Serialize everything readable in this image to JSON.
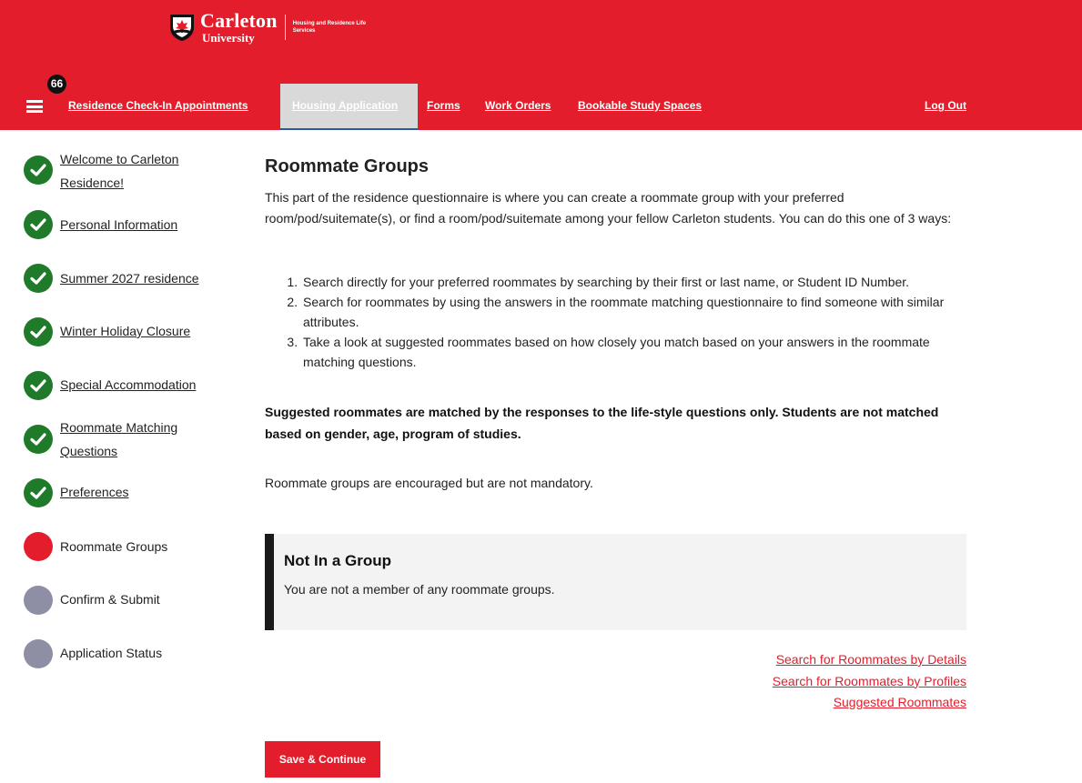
{
  "header": {
    "logo_name": "Carleton",
    "logo_university": "University",
    "logo_department": "Housing and Residence Life Services",
    "notification_count": "66",
    "nav": [
      {
        "label": "Residence Check-In Appointments"
      },
      {
        "label": "Housing Application",
        "active": true
      },
      {
        "label": "Forms"
      },
      {
        "label": "Work Orders"
      },
      {
        "label": "Bookable Study Spaces"
      }
    ],
    "logout_label": "Log Out"
  },
  "sidebar": {
    "steps": [
      {
        "label": "Welcome to Carleton Residence!",
        "status": "complete"
      },
      {
        "label": "Personal Information",
        "status": "complete"
      },
      {
        "label": "Summer 2027 residence",
        "status": "complete"
      },
      {
        "label": "Winter Holiday Closure",
        "status": "complete"
      },
      {
        "label": "Special Accommodation",
        "status": "complete"
      },
      {
        "label": "Roommate Matching Questions",
        "status": "complete"
      },
      {
        "label": "Preferences",
        "status": "complete"
      },
      {
        "label": "Roommate Groups",
        "status": "current"
      },
      {
        "label": "Confirm & Submit",
        "status": "pending"
      },
      {
        "label": "Application Status",
        "status": "pending"
      }
    ]
  },
  "main": {
    "title": "Roommate Groups",
    "intro": "This part of the residence questionnaire is where you can create a roommate group with your preferred room/pod/suitemate(s), or find a room/pod/suitemate among your fellow Carleton students. You can do this one of 3 ways:",
    "ways": [
      "Search directly for your preferred roommates by searching by their first or last name, or Student ID Number.",
      "Search for roommates by using the answers in the roommate matching questionnaire to find someone with similar attributes.",
      "Take a look at suggested roommates based on how closely you match based on your answers in the roommate matching questions."
    ],
    "note": "Suggested roommates are matched by the responses to the life-style questions only. Students are not matched based on gender, age, program of studies.",
    "encouraged": "Roommate groups are encouraged but are not mandatory.",
    "group_box": {
      "title": "Not In a Group",
      "text": "You are not a member of any roommate groups."
    },
    "links": [
      "Search for Roommates by Details",
      "Search for Roommates by Profiles",
      "Suggested Roommates"
    ],
    "save_button": "Save & Continue"
  },
  "colors": {
    "brand_red": "#e31d2b",
    "complete_green": "#1f7a2a",
    "pending_gray": "#8e8fa5"
  }
}
